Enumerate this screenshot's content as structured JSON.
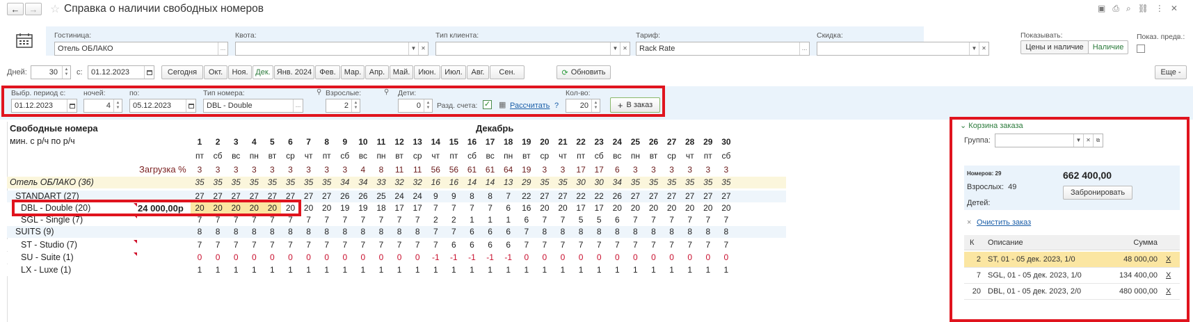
{
  "window": {
    "title": "Справка о наличии свободных номеров"
  },
  "filters": {
    "hotel_label": "Гостиница:",
    "hotel_value": "Отель ОБЛАКО",
    "quota_label": "Квота:",
    "quota_value": "",
    "client_type_label": "Тип клиента:",
    "client_type_value": "",
    "tariff_label": "Тариф:",
    "tariff_value": "Rack Rate",
    "discount_label": "Скидка:",
    "discount_value": "",
    "show_label": "Показывать:",
    "show_prices_btn": "Цены и наличие",
    "show_avail_btn": "Наличие",
    "show_prev_label": "Показ. предв.:"
  },
  "period": {
    "days_label": "Дней:",
    "days_value": "30",
    "from_label": "с:",
    "from_value": "01.12.2023",
    "today_btn": "Сегодня",
    "months": [
      "Окт.",
      "Ноя.",
      "Дек.",
      "Янв. 2024",
      "Фев.",
      "Мар.",
      "Апр.",
      "Май.",
      "Июн.",
      "Июл.",
      "Авг.",
      "Сен."
    ],
    "active_month": "Дек.",
    "refresh_btn": "Обновить",
    "more_btn": "Еще -"
  },
  "booking": {
    "period_label": "Выбр. период с:",
    "period_from": "01.12.2023",
    "nights_label": "ночей:",
    "nights_value": "4",
    "to_label": "по:",
    "to_value": "05.12.2023",
    "room_type_label": "Тип номера:",
    "room_type_value": "DBL - Double",
    "adults_label": "Взрослые:",
    "adults_value": "2",
    "children_label": "Дети:",
    "children_value": "0",
    "split_label": "Разд. счета:",
    "calc_link": "Рассчитать",
    "help": "?",
    "qty_label": "Кол-во:",
    "qty_value": "20",
    "add_btn": "В заказ"
  },
  "grid": {
    "title": "Свободные номера",
    "subtitle": "мин. с р/ч по р/ч",
    "month": "Декабрь",
    "load_label": "Загрузка %",
    "days": [
      "1",
      "2",
      "3",
      "4",
      "5",
      "6",
      "7",
      "8",
      "9",
      "10",
      "11",
      "12",
      "13",
      "14",
      "15",
      "16",
      "17",
      "18",
      "19",
      "20",
      "21",
      "22",
      "23",
      "24",
      "25",
      "26",
      "27",
      "28",
      "29",
      "30"
    ],
    "weekdays": [
      "пт",
      "сб",
      "вс",
      "пн",
      "вт",
      "ср",
      "чт",
      "пт",
      "сб",
      "вс",
      "пн",
      "вт",
      "ср",
      "чт",
      "пт",
      "сб",
      "вс",
      "пн",
      "вт",
      "ср",
      "чт",
      "пт",
      "сб",
      "вс",
      "пн",
      "вт",
      "ср",
      "чт",
      "пт",
      "сб"
    ],
    "load": [
      "3",
      "3",
      "3",
      "3",
      "3",
      "3",
      "3",
      "3",
      "3",
      "4",
      "8",
      "11",
      "11",
      "56",
      "56",
      "61",
      "61",
      "64",
      "19",
      "3",
      "3",
      "17",
      "17",
      "6",
      "3",
      "3",
      "3",
      "3",
      "3",
      "3"
    ],
    "rows": [
      {
        "name": "Отель ОБЛАКО (36)",
        "price": "",
        "values": [
          "35",
          "35",
          "35",
          "35",
          "35",
          "35",
          "35",
          "35",
          "34",
          "34",
          "33",
          "32",
          "32",
          "16",
          "16",
          "14",
          "14",
          "13",
          "29",
          "35",
          "35",
          "30",
          "30",
          "34",
          "35",
          "35",
          "35",
          "35",
          "35",
          "35"
        ]
      },
      {
        "name": "STANDART (27)",
        "price": "",
        "values": [
          "27",
          "27",
          "27",
          "27",
          "27",
          "27",
          "27",
          "27",
          "26",
          "26",
          "25",
          "24",
          "24",
          "9",
          "9",
          "8",
          "8",
          "7",
          "22",
          "27",
          "27",
          "22",
          "22",
          "26",
          "27",
          "27",
          "27",
          "27",
          "27",
          "27"
        ]
      },
      {
        "name": "DBL - Double (20)",
        "price": "24 000,00р",
        "values": [
          "20",
          "20",
          "20",
          "20",
          "20",
          "20",
          "20",
          "20",
          "19",
          "19",
          "18",
          "17",
          "17",
          "7",
          "7",
          "7",
          "7",
          "6",
          "16",
          "20",
          "20",
          "17",
          "17",
          "20",
          "20",
          "20",
          "20",
          "20",
          "20",
          "20"
        ]
      },
      {
        "name": "SGL - Single (7)",
        "price": "",
        "values": [
          "7",
          "7",
          "7",
          "7",
          "7",
          "7",
          "7",
          "7",
          "7",
          "7",
          "7",
          "7",
          "7",
          "2",
          "2",
          "1",
          "1",
          "1",
          "6",
          "7",
          "7",
          "5",
          "5",
          "6",
          "7",
          "7",
          "7",
          "7",
          "7",
          "7"
        ]
      },
      {
        "name": "SUITS (9)",
        "price": "",
        "values": [
          "8",
          "8",
          "8",
          "8",
          "8",
          "8",
          "8",
          "8",
          "8",
          "8",
          "8",
          "8",
          "8",
          "7",
          "7",
          "6",
          "6",
          "6",
          "7",
          "8",
          "8",
          "8",
          "8",
          "8",
          "8",
          "8",
          "8",
          "8",
          "8",
          "8"
        ]
      },
      {
        "name": "ST - Studio (7)",
        "price": "",
        "values": [
          "7",
          "7",
          "7",
          "7",
          "7",
          "7",
          "7",
          "7",
          "7",
          "7",
          "7",
          "7",
          "7",
          "7",
          "6",
          "6",
          "6",
          "6",
          "7",
          "7",
          "7",
          "7",
          "7",
          "7",
          "7",
          "7",
          "7",
          "7",
          "7",
          "7"
        ]
      },
      {
        "name": "SU - Suite (1)",
        "price": "",
        "values": [
          "0",
          "0",
          "0",
          "0",
          "0",
          "0",
          "0",
          "0",
          "0",
          "0",
          "0",
          "0",
          "0",
          "-1",
          "-1",
          "-1",
          "-1",
          "-1",
          "0",
          "0",
          "0",
          "0",
          "0",
          "0",
          "0",
          "0",
          "0",
          "0",
          "0",
          "0"
        ]
      },
      {
        "name": "LX - Luxe (1)",
        "price": "",
        "values": [
          "1",
          "1",
          "1",
          "1",
          "1",
          "1",
          "1",
          "1",
          "1",
          "1",
          "1",
          "1",
          "1",
          "1",
          "1",
          "1",
          "1",
          "1",
          "1",
          "1",
          "1",
          "1",
          "1",
          "1",
          "1",
          "1",
          "1",
          "1",
          "1",
          "1"
        ]
      }
    ]
  },
  "cart": {
    "title": "Корзина заказа",
    "group_label": "Группа:",
    "rooms_label": "Номеров:",
    "rooms_value": "29",
    "total": "662 400,00",
    "adults_label": "Взрослых:",
    "adults_value": "49",
    "children_label": "Детей:",
    "book_btn": "Забронировать",
    "clear_link": "Очистить заказ",
    "col_k": "К",
    "col_desc": "Описание",
    "col_sum": "Сумма",
    "items": [
      {
        "k": "2",
        "desc": "ST, 01 - 05 дек. 2023, 1/0",
        "sum": "48 000,00",
        "del": "X"
      },
      {
        "k": "7",
        "desc": "SGL, 01 - 05 дек. 2023, 1/0",
        "sum": "134 400,00",
        "del": "X"
      },
      {
        "k": "20",
        "desc": "DBL, 01 - 05 дек. 2023, 2/0",
        "sum": "480 000,00",
        "del": "X"
      }
    ]
  },
  "colors": {
    "accent_green": "#2a7a3a",
    "highlight_red": "#e0141e",
    "selected_yellow": "#fbe6a2",
    "hotel_row": "#fbf6dc",
    "stripe_blue": "#eef5fb"
  }
}
